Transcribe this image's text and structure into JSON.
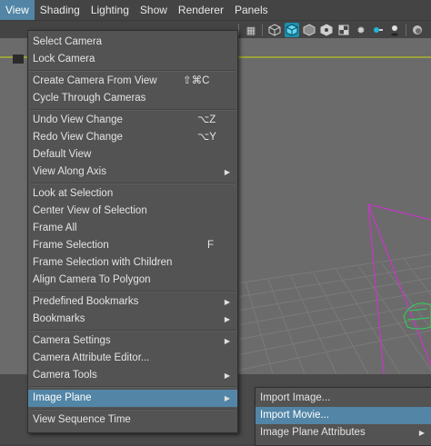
{
  "menubar": {
    "items": [
      "View",
      "Shading",
      "Lighting",
      "Show",
      "Renderer",
      "Panels"
    ]
  },
  "toolbar": {
    "icons": [
      "wireframe-icon",
      "smooth-shade-icon",
      "shade-all-icon",
      "textured-icon",
      "default-light-icon",
      "lights-icon",
      "shadows-icon",
      "ambient-occlusion-icon",
      "motion-blur-icon",
      "anti-aliasing-icon"
    ]
  },
  "view_menu": {
    "items": [
      {
        "label": "Select Camera"
      },
      {
        "label": "Lock Camera"
      },
      {
        "label": "Create Camera From View",
        "shortcut": "⇧⌘C"
      },
      {
        "label": "Cycle Through Cameras"
      },
      {
        "label": "Undo View Change",
        "shortcut": "⌥Z"
      },
      {
        "label": "Redo View Change",
        "shortcut": "⌥Y"
      },
      {
        "label": "Default View"
      },
      {
        "label": "View Along Axis"
      },
      {
        "label": "Look at Selection"
      },
      {
        "label": "Center View of Selection"
      },
      {
        "label": "Frame All"
      },
      {
        "label": "Frame Selection",
        "shortcut": "F"
      },
      {
        "label": "Frame Selection with Children"
      },
      {
        "label": "Align Camera To Polygon"
      },
      {
        "label": "Predefined Bookmarks"
      },
      {
        "label": "Bookmarks"
      },
      {
        "label": "Camera Settings"
      },
      {
        "label": "Camera Attribute Editor..."
      },
      {
        "label": "Camera Tools"
      },
      {
        "label": "Image Plane"
      },
      {
        "label": "View Sequence Time"
      }
    ]
  },
  "image_plane_submenu": {
    "items": [
      {
        "label": "Import Image..."
      },
      {
        "label": "Import Movie..."
      },
      {
        "label": "Image Plane Attributes"
      }
    ]
  },
  "colors": {
    "highlight": "#5285a6",
    "menu_bg": "#535353",
    "active_icon": "#1b8fae",
    "camera_frustum": "#c23ac2",
    "mesh": "#2fd15a"
  }
}
